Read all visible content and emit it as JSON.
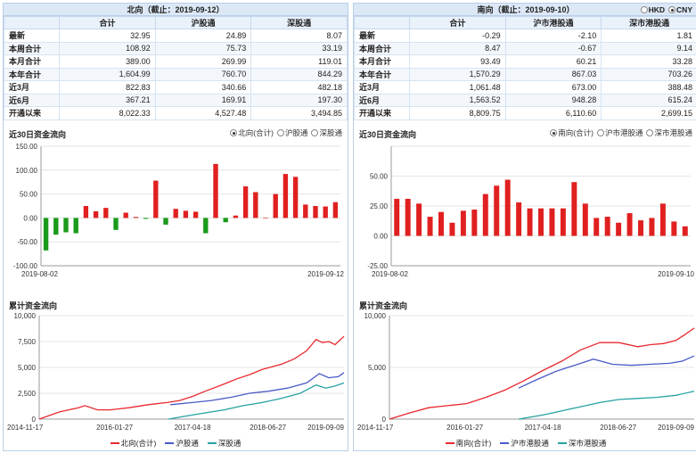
{
  "north": {
    "title": "北向（截止：2019-09-12）",
    "headers": [
      "",
      "合计",
      "沪股通",
      "深股通"
    ],
    "rows": [
      {
        "label": "最新",
        "v": [
          "32.95",
          "24.89",
          "8.07"
        ]
      },
      {
        "label": "本周合计",
        "v": [
          "108.92",
          "75.73",
          "33.19"
        ]
      },
      {
        "label": "本月合计",
        "v": [
          "389.00",
          "269.99",
          "119.01"
        ]
      },
      {
        "label": "本年合计",
        "v": [
          "1,604.99",
          "760.70",
          "844.29"
        ]
      },
      {
        "label": "近3月",
        "v": [
          "822.83",
          "340.66",
          "482.18"
        ]
      },
      {
        "label": "近6月",
        "v": [
          "367.21",
          "169.91",
          "197.30"
        ]
      },
      {
        "label": "开通以来",
        "v": [
          "8,022.33",
          "4,527.48",
          "3,494.85"
        ]
      }
    ],
    "flow_title": "近30日资金流向",
    "flow_options": [
      {
        "label": "北向(合计)",
        "selected": true
      },
      {
        "label": "沪股通",
        "selected": false
      },
      {
        "label": "深股通",
        "selected": false
      }
    ],
    "cum_title": "累计资金流向"
  },
  "south": {
    "title": "南向（截止：2019-09-10）",
    "headers": [
      "",
      "合计",
      "沪市港股通",
      "深市港股通"
    ],
    "rows": [
      {
        "label": "最新",
        "v": [
          "-0.29",
          "-2.10",
          "1.81"
        ]
      },
      {
        "label": "本周合计",
        "v": [
          "8.47",
          "-0.67",
          "9.14"
        ]
      },
      {
        "label": "本月合计",
        "v": [
          "93.49",
          "60.21",
          "33.28"
        ]
      },
      {
        "label": "本年合计",
        "v": [
          "1,570.29",
          "867.03",
          "703.26"
        ]
      },
      {
        "label": "近3月",
        "v": [
          "1,061.48",
          "673.00",
          "388.48"
        ]
      },
      {
        "label": "近6月",
        "v": [
          "1,563.52",
          "948.28",
          "615.24"
        ]
      },
      {
        "label": "开通以来",
        "v": [
          "8,809.75",
          "6,110.60",
          "2,699.15"
        ]
      }
    ],
    "flow_title": "近30日资金流向",
    "flow_options": [
      {
        "label": "南向(合计)",
        "selected": true
      },
      {
        "label": "沪市港股通",
        "selected": false
      },
      {
        "label": "深市港股通",
        "selected": false
      }
    ],
    "cum_title": "累计资金流向",
    "currency": [
      {
        "label": "HKD",
        "selected": false
      },
      {
        "label": "CNY",
        "selected": true
      }
    ]
  },
  "chart_data": [
    {
      "id": "north_flow",
      "type": "bar",
      "ylim": [
        -100,
        150
      ],
      "yticks": [
        -100,
        -50,
        0,
        50,
        100,
        150
      ],
      "ytick_labels": [
        "-100.00",
        "-50.00",
        "0.00",
        "50.00",
        "100.00",
        "150.00"
      ],
      "xtick_labels": [
        "2019-08-02",
        "2019-09-12"
      ],
      "positive_color": "#e02020",
      "negative_color": "#1a9a1a",
      "values": [
        -68,
        -35,
        -30,
        -32,
        25,
        14,
        21,
        -25,
        11,
        2,
        -2,
        78,
        -14,
        19,
        15,
        13,
        -32,
        113,
        -9,
        5,
        66,
        54,
        0,
        50,
        92,
        86,
        28,
        25,
        24,
        33
      ]
    },
    {
      "id": "south_flow",
      "type": "bar",
      "ylim": [
        -25,
        75
      ],
      "yticks": [
        -25,
        0,
        25,
        50,
        75
      ],
      "ytick_labels": [
        "-25.00",
        "0.00",
        "25.00",
        "50.00",
        ""
      ],
      "xtick_labels": [
        "2019-08-02",
        "2019-09-10"
      ],
      "positive_color": "#e02020",
      "negative_color": "#1a9a1a",
      "values": [
        31,
        31,
        27,
        16,
        20,
        11,
        21,
        22,
        35,
        42,
        47,
        28,
        23,
        23,
        23,
        23,
        45,
        27,
        15,
        16,
        11,
        19,
        13,
        15,
        27,
        12,
        8
      ]
    },
    {
      "id": "north_cum",
      "type": "line",
      "ylim": [
        0,
        10000
      ],
      "yticks": [
        0,
        2500,
        5000,
        7500,
        10000
      ],
      "ytick_labels": [
        "0",
        "2,500",
        "5,000",
        "7,500",
        "10,000"
      ],
      "xlim": [
        2014.88,
        2019.69
      ],
      "xticks": [
        2014.88,
        2016.07,
        2017.3,
        2018.49,
        2019.69
      ],
      "xtick_labels": [
        "2014-11-17",
        "2016-01-27",
        "2017-04-18",
        "2018-06-27",
        "2019-09-09"
      ],
      "series": [
        {
          "name": "北向(合计)",
          "color": "#e8292e",
          "x": [
            2014.88,
            2015.2,
            2015.5,
            2015.6,
            2015.8,
            2016.0,
            2016.3,
            2016.6,
            2016.9,
            2017.1,
            2017.3,
            2017.5,
            2017.8,
            2018.0,
            2018.2,
            2018.4,
            2018.7,
            2018.9,
            2019.1,
            2019.25,
            2019.35,
            2019.45,
            2019.55,
            2019.69
          ],
          "y": [
            0,
            700,
            1100,
            1300,
            900,
            900,
            1100,
            1400,
            1600,
            1800,
            2200,
            2700,
            3400,
            3900,
            4300,
            4800,
            5300,
            5800,
            6600,
            7700,
            7400,
            7500,
            7200,
            8000
          ]
        },
        {
          "name": "沪股通",
          "color": "#4a5bc6",
          "x": [
            2016.95,
            2017.3,
            2017.6,
            2017.9,
            2018.2,
            2018.5,
            2018.8,
            2019.1,
            2019.3,
            2019.45,
            2019.6,
            2019.69
          ],
          "y": [
            1400,
            1600,
            1800,
            2100,
            2500,
            2700,
            3000,
            3500,
            4400,
            4000,
            4100,
            4500
          ]
        },
        {
          "name": "深股通",
          "color": "#27a2a4",
          "x": [
            2016.92,
            2017.2,
            2017.5,
            2017.8,
            2018.1,
            2018.4,
            2018.7,
            2019.0,
            2019.25,
            2019.4,
            2019.55,
            2019.69
          ],
          "y": [
            0,
            300,
            600,
            900,
            1300,
            1600,
            2000,
            2500,
            3300,
            3000,
            3200,
            3500
          ]
        }
      ]
    },
    {
      "id": "south_cum",
      "type": "line",
      "ylim": [
        0,
        10000
      ],
      "yticks": [
        0,
        5000,
        10000
      ],
      "ytick_labels": [
        "0",
        "5,000",
        "10,000"
      ],
      "xlim": [
        2014.88,
        2019.69
      ],
      "xticks": [
        2014.88,
        2016.07,
        2017.3,
        2018.49,
        2019.69
      ],
      "xtick_labels": [
        "2014-11-17",
        "2016-01-27",
        "2017-04-18",
        "2018-06-27",
        "2019-09-09"
      ],
      "series": [
        {
          "name": "南向(合计)",
          "color": "#e8292e",
          "x": [
            2014.88,
            2015.2,
            2015.5,
            2015.8,
            2016.1,
            2016.4,
            2016.7,
            2017.0,
            2017.3,
            2017.6,
            2017.9,
            2018.2,
            2018.5,
            2018.8,
            2019.0,
            2019.2,
            2019.4,
            2019.55,
            2019.69
          ],
          "y": [
            0,
            600,
            1100,
            1300,
            1500,
            2100,
            2800,
            3700,
            4700,
            5600,
            6700,
            7400,
            7400,
            7000,
            7200,
            7300,
            7600,
            8200,
            8800
          ]
        },
        {
          "name": "沪市港股通",
          "color": "#4a5bc6",
          "x": [
            2016.92,
            2017.2,
            2017.5,
            2017.8,
            2018.1,
            2018.4,
            2018.7,
            2019.0,
            2019.3,
            2019.5,
            2019.69
          ],
          "y": [
            3000,
            3800,
            4600,
            5200,
            5800,
            5300,
            5200,
            5300,
            5400,
            5600,
            6100
          ]
        },
        {
          "name": "深市港股通",
          "color": "#27a2a4",
          "x": [
            2016.92,
            2017.3,
            2017.6,
            2017.9,
            2018.2,
            2018.5,
            2018.8,
            2019.1,
            2019.4,
            2019.69
          ],
          "y": [
            0,
            400,
            800,
            1200,
            1600,
            1900,
            2000,
            2100,
            2300,
            2700
          ]
        }
      ]
    }
  ]
}
